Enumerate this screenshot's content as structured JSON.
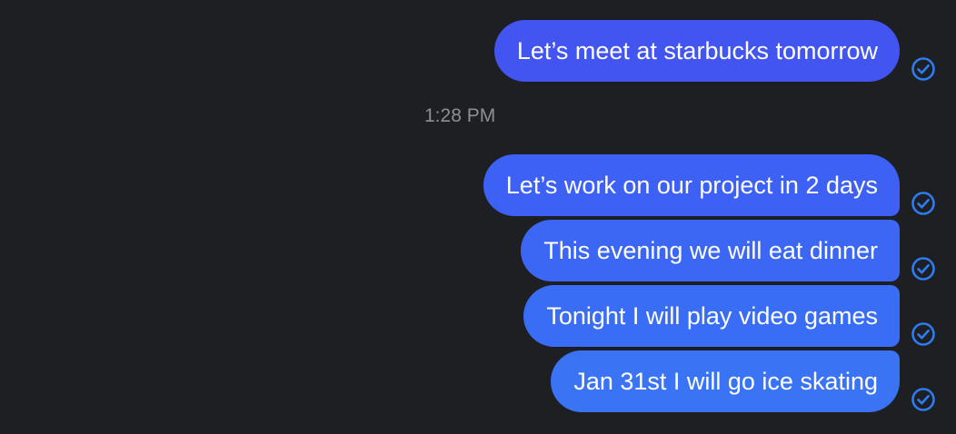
{
  "messages": [
    {
      "text": "Let’s meet at starbucks tomorrow",
      "status_icon": "check-circle-icon",
      "color": "#4355f0"
    },
    {
      "text": "Let’s work on our project in 2 days",
      "status_icon": "check-circle-icon",
      "color": "#3c61f4"
    },
    {
      "text": "This evening we will eat dinner",
      "status_icon": "check-circle-icon",
      "color": "#3b67f4"
    },
    {
      "text": "Tonight I will play video games",
      "status_icon": "check-circle-icon",
      "color": "#3a6df5"
    },
    {
      "text": "Jan 31st I will go ice skating",
      "status_icon": "check-circle-icon",
      "color": "#3a74f5"
    }
  ],
  "timestamp": "1:28 PM",
  "colors": {
    "background": "#1e1f22",
    "receipt": "#2e7cf2",
    "timestamp": "#8e8f93"
  }
}
